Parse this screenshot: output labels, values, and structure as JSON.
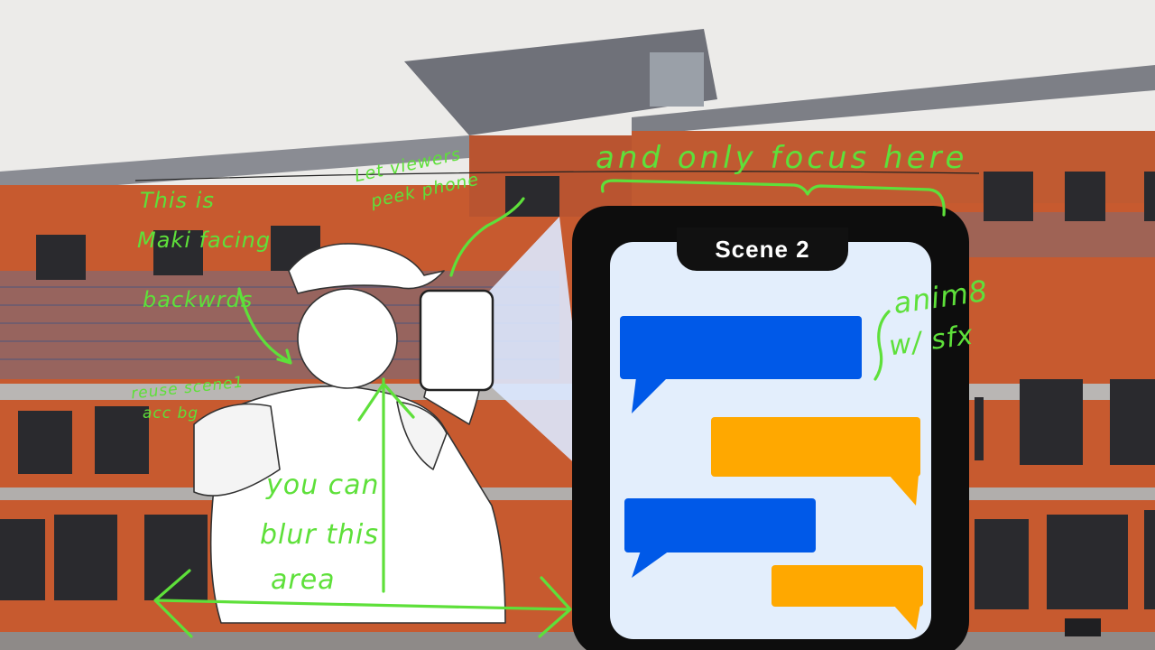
{
  "phone": {
    "scene_label": "Scene 2"
  },
  "annotations": {
    "focus": "and only focus here",
    "peek": [
      "Let viewers",
      "peek phone"
    ],
    "maki": [
      "This is",
      "Maki facing",
      "backwrds"
    ],
    "reuse": [
      "reuse scene1",
      "acc bg"
    ],
    "anim": [
      "anim8",
      "w/ sfx"
    ],
    "blur": [
      "you can",
      "blur this",
      "area"
    ]
  },
  "colors": {
    "annotation": "#5ee03a",
    "incoming_bubble": "#0059e8",
    "outgoing_bubble": "#ffa800",
    "building": "#c75a2f",
    "sky": "#ecebe9"
  }
}
